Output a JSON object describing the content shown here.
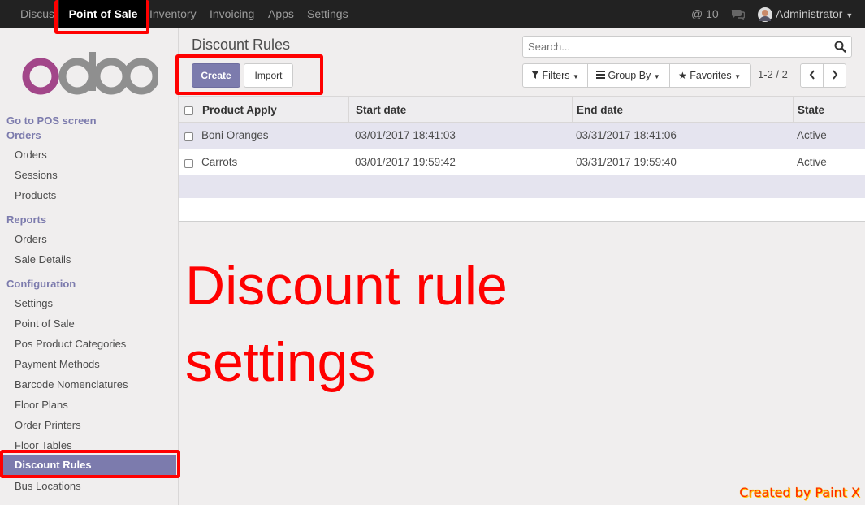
{
  "topbar": {
    "menu": [
      "Discuss",
      "Point of Sale",
      "Inventory",
      "Invoicing",
      "Apps",
      "Settings"
    ],
    "notifications": "@ 10",
    "user": "Administrator"
  },
  "sidebar": {
    "goto_pos": "Go to POS screen",
    "orders_head": "Orders",
    "orders_items": [
      "Orders",
      "Sessions",
      "Products"
    ],
    "reports_head": "Reports",
    "reports_items": [
      "Orders",
      "Sale Details"
    ],
    "config_head": "Configuration",
    "config_items": [
      "Settings",
      "Point of Sale",
      "Pos Product Categories",
      "Payment Methods",
      "Barcode Nomenclatures",
      "Floor Plans",
      "Order Printers",
      "Floor Tables",
      "Discount Rules",
      "Bus Locations"
    ]
  },
  "page": {
    "title": "Discount Rules",
    "create_label": "Create",
    "import_label": "Import",
    "search_placeholder": "Search...",
    "filters_label": "Filters",
    "groupby_label": "Group By",
    "favorites_label": "Favorites",
    "pager": "1-2 / 2"
  },
  "table": {
    "headers": [
      "Product Apply",
      "Start date",
      "End date",
      "State"
    ],
    "rows": [
      [
        "Boni Oranges",
        "03/01/2017 18:41:03",
        "03/31/2017 18:41:06",
        "Active"
      ],
      [
        "Carrots",
        "03/01/2017 19:59:42",
        "03/31/2017 19:59:40",
        "Active"
      ]
    ]
  },
  "annotation": {
    "line1": "Discount rule",
    "line2": "settings",
    "credit": "Created by Paint X"
  },
  "colors": {
    "brand": "#7c7bad",
    "topbar": "#222222",
    "annotation": "#ff0000"
  }
}
